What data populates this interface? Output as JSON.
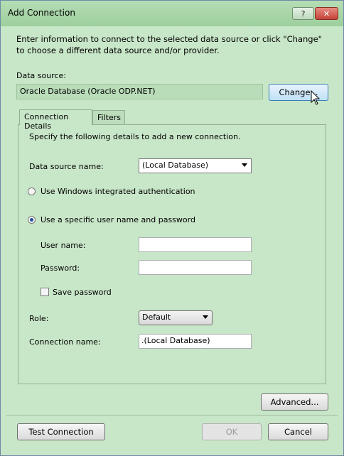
{
  "window": {
    "title": "Add Connection",
    "help_glyph": "?",
    "close_glyph": "✕"
  },
  "intro_text": "Enter information to connect to the selected data source or click \"Change\" to choose a different data source and/or provider.",
  "data_source": {
    "label": "Data source:",
    "value": "Oracle Database (Oracle ODP.NET)",
    "change_button": "Change..."
  },
  "tabs": [
    {
      "label": "Connection Details",
      "active": true
    },
    {
      "label": "Filters",
      "active": false
    }
  ],
  "details": {
    "instructions": "Specify the following details to add a new connection.",
    "data_source_name_label": "Data source name:",
    "data_source_name_value": "(Local Database)",
    "auth_windows_label": "Use Windows integrated authentication",
    "auth_specific_label": "Use a specific user name and password",
    "auth_selected": "specific",
    "user_name_label": "User name:",
    "user_name_value": "",
    "password_label": "Password:",
    "password_value": "",
    "save_password_label": "Save password",
    "save_password_checked": false,
    "role_label": "Role:",
    "role_value": "Default",
    "connection_name_label": "Connection name:",
    "connection_name_value": ".(Local Database)"
  },
  "buttons": {
    "advanced": "Advanced...",
    "test_connection": "Test Connection",
    "ok": "OK",
    "cancel": "Cancel"
  },
  "colors": {
    "background": "#c8e6c8",
    "title_bar": "#9dcf9d",
    "close_button": "#c3433a"
  },
  "icons": {
    "cursor": "mouse-pointer-icon",
    "dropdown": "chevron-down-icon"
  }
}
